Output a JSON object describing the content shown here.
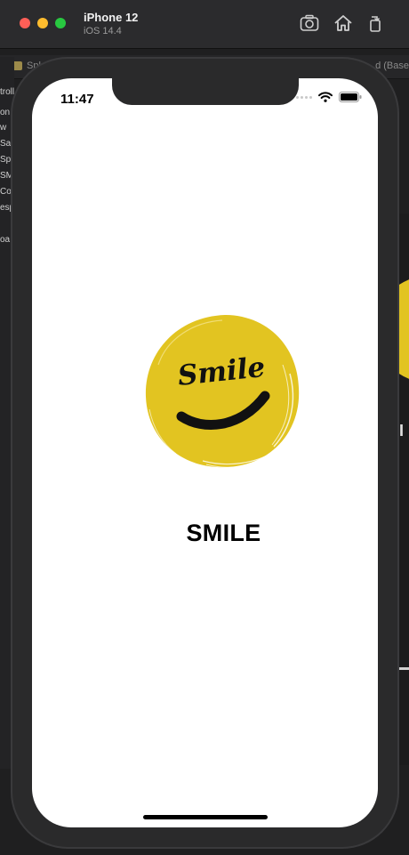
{
  "simulator": {
    "device_name": "iPhone 12",
    "os_version": "iOS 14.4",
    "buttons": [
      "screenshot-icon",
      "home-icon",
      "rotate-icon"
    ]
  },
  "xcode_background": {
    "breadcrumb_left": "Spl",
    "breadcrumb_right": "d (Base",
    "sidebar_fragments": [
      "troll",
      "on",
      "w",
      "Saf",
      "Spl",
      "SMI",
      "Co",
      "esp",
      "oa"
    ],
    "right_fragment": "II"
  },
  "status_bar": {
    "time": "11:47"
  },
  "app": {
    "logo_text": "Smile",
    "title": "SMILE",
    "accent_color": "#e2c421"
  }
}
